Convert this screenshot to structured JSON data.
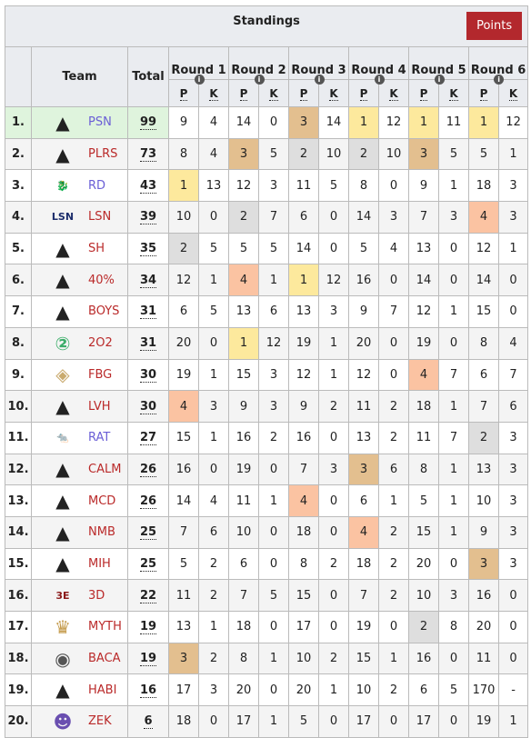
{
  "title": "Standings",
  "points_button": "Points",
  "headers": {
    "team": "Team",
    "total": "Total",
    "rounds": [
      "Round 1",
      "Round 2",
      "Round 3",
      "Round 4",
      "Round 5",
      "Round 6"
    ],
    "p": "P",
    "k": "K"
  },
  "colors": {
    "gold": "#fde99d",
    "silver": "#dedede",
    "bronze": "#e3bf8f",
    "fourth": "#fbc3a2",
    "leader": "#dff4dd",
    "button": "#b3282d",
    "link_blue": "#6b5fd6",
    "link_red": "#ba2a2a"
  },
  "rows": [
    {
      "rank": "1.",
      "team": "PSN",
      "logo": "apex-logo",
      "link": "blue",
      "total": "99",
      "r": [
        [
          "9",
          "4"
        ],
        [
          "14",
          "0"
        ],
        [
          "3",
          "14"
        ],
        [
          "1",
          "12"
        ],
        [
          "1",
          "11"
        ],
        [
          "1",
          "12"
        ]
      ]
    },
    {
      "rank": "2.",
      "team": "PLRS",
      "logo": "apex-logo",
      "link": "red",
      "total": "73",
      "r": [
        [
          "8",
          "4"
        ],
        [
          "3",
          "5"
        ],
        [
          "2",
          "10"
        ],
        [
          "2",
          "10"
        ],
        [
          "3",
          "5"
        ],
        [
          "5",
          "1"
        ]
      ]
    },
    {
      "rank": "3.",
      "team": "RD",
      "logo": "red-dragon-logo",
      "link": "blue",
      "total": "43",
      "r": [
        [
          "1",
          "13"
        ],
        [
          "12",
          "3"
        ],
        [
          "11",
          "5"
        ],
        [
          "8",
          "0"
        ],
        [
          "9",
          "1"
        ],
        [
          "18",
          "3"
        ]
      ]
    },
    {
      "rank": "4.",
      "team": "LSN",
      "logo": "lsn-logo",
      "link": "red",
      "total": "39",
      "r": [
        [
          "10",
          "0"
        ],
        [
          "2",
          "7"
        ],
        [
          "6",
          "0"
        ],
        [
          "14",
          "3"
        ],
        [
          "7",
          "3"
        ],
        [
          "4",
          "3"
        ]
      ]
    },
    {
      "rank": "5.",
      "team": "SH",
      "logo": "apex-logo",
      "link": "red",
      "total": "35",
      "r": [
        [
          "2",
          "5"
        ],
        [
          "5",
          "5"
        ],
        [
          "14",
          "0"
        ],
        [
          "5",
          "4"
        ],
        [
          "13",
          "0"
        ],
        [
          "12",
          "1"
        ]
      ]
    },
    {
      "rank": "6.",
      "team": "40%",
      "logo": "apex-logo",
      "link": "red",
      "total": "34",
      "r": [
        [
          "12",
          "1"
        ],
        [
          "4",
          "1"
        ],
        [
          "1",
          "12"
        ],
        [
          "16",
          "0"
        ],
        [
          "14",
          "0"
        ],
        [
          "14",
          "0"
        ]
      ]
    },
    {
      "rank": "7.",
      "team": "BOYS",
      "logo": "apex-logo",
      "link": "red",
      "total": "31",
      "r": [
        [
          "6",
          "5"
        ],
        [
          "13",
          "6"
        ],
        [
          "13",
          "3"
        ],
        [
          "9",
          "7"
        ],
        [
          "12",
          "1"
        ],
        [
          "15",
          "0"
        ]
      ]
    },
    {
      "rank": "8.",
      "team": "2O2",
      "logo": "2o2-logo",
      "link": "red",
      "total": "31",
      "r": [
        [
          "20",
          "0"
        ],
        [
          "1",
          "12"
        ],
        [
          "19",
          "1"
        ],
        [
          "20",
          "0"
        ],
        [
          "19",
          "0"
        ],
        [
          "8",
          "4"
        ]
      ]
    },
    {
      "rank": "9.",
      "team": "FBG",
      "logo": "fbg-logo",
      "link": "red",
      "total": "30",
      "r": [
        [
          "19",
          "1"
        ],
        [
          "15",
          "3"
        ],
        [
          "12",
          "1"
        ],
        [
          "12",
          "0"
        ],
        [
          "4",
          "7"
        ],
        [
          "6",
          "7"
        ]
      ]
    },
    {
      "rank": "10.",
      "team": "LVH",
      "logo": "apex-logo",
      "link": "red",
      "total": "30",
      "r": [
        [
          "4",
          "3"
        ],
        [
          "9",
          "3"
        ],
        [
          "9",
          "2"
        ],
        [
          "11",
          "2"
        ],
        [
          "18",
          "1"
        ],
        [
          "7",
          "6"
        ]
      ]
    },
    {
      "rank": "11.",
      "team": "RAT",
      "logo": "rat-logo",
      "link": "blue",
      "total": "27",
      "r": [
        [
          "15",
          "1"
        ],
        [
          "16",
          "2"
        ],
        [
          "16",
          "0"
        ],
        [
          "13",
          "2"
        ],
        [
          "11",
          "7"
        ],
        [
          "2",
          "3"
        ]
      ]
    },
    {
      "rank": "12.",
      "team": "CALM",
      "logo": "apex-logo",
      "link": "red",
      "total": "26",
      "r": [
        [
          "16",
          "0"
        ],
        [
          "19",
          "0"
        ],
        [
          "7",
          "3"
        ],
        [
          "3",
          "6"
        ],
        [
          "8",
          "1"
        ],
        [
          "13",
          "3"
        ]
      ]
    },
    {
      "rank": "13.",
      "team": "MCD",
      "logo": "apex-logo",
      "link": "red",
      "total": "26",
      "r": [
        [
          "14",
          "4"
        ],
        [
          "11",
          "1"
        ],
        [
          "4",
          "0"
        ],
        [
          "6",
          "1"
        ],
        [
          "5",
          "1"
        ],
        [
          "10",
          "3"
        ]
      ]
    },
    {
      "rank": "14.",
      "team": "NMB",
      "logo": "apex-logo",
      "link": "red",
      "total": "25",
      "r": [
        [
          "7",
          "6"
        ],
        [
          "10",
          "0"
        ],
        [
          "18",
          "0"
        ],
        [
          "4",
          "2"
        ],
        [
          "15",
          "1"
        ],
        [
          "9",
          "3"
        ]
      ]
    },
    {
      "rank": "15.",
      "team": "MIH",
      "logo": "apex-logo",
      "link": "red",
      "total": "25",
      "r": [
        [
          "5",
          "2"
        ],
        [
          "6",
          "0"
        ],
        [
          "8",
          "2"
        ],
        [
          "18",
          "2"
        ],
        [
          "20",
          "0"
        ],
        [
          "3",
          "3"
        ]
      ]
    },
    {
      "rank": "16.",
      "team": "3D",
      "logo": "3d-dragon-logo",
      "link": "red",
      "total": "22",
      "r": [
        [
          "11",
          "2"
        ],
        [
          "7",
          "5"
        ],
        [
          "15",
          "0"
        ],
        [
          "7",
          "2"
        ],
        [
          "10",
          "3"
        ],
        [
          "16",
          "0"
        ]
      ]
    },
    {
      "rank": "17.",
      "team": "MYTH",
      "logo": "myth-logo",
      "link": "red",
      "total": "19",
      "r": [
        [
          "13",
          "1"
        ],
        [
          "18",
          "0"
        ],
        [
          "17",
          "0"
        ],
        [
          "19",
          "0"
        ],
        [
          "2",
          "8"
        ],
        [
          "20",
          "0"
        ]
      ]
    },
    {
      "rank": "18.",
      "team": "BACA",
      "logo": "baca-logo",
      "link": "red",
      "total": "19",
      "r": [
        [
          "3",
          "2"
        ],
        [
          "8",
          "1"
        ],
        [
          "10",
          "2"
        ],
        [
          "15",
          "1"
        ],
        [
          "16",
          "0"
        ],
        [
          "11",
          "0"
        ]
      ]
    },
    {
      "rank": "19.",
      "team": "HABI",
      "logo": "apex-logo",
      "link": "red",
      "total": "16",
      "r": [
        [
          "17",
          "3"
        ],
        [
          "20",
          "0"
        ],
        [
          "20",
          "1"
        ],
        [
          "10",
          "2"
        ],
        [
          "6",
          "5"
        ],
        [
          "170",
          "-"
        ]
      ]
    },
    {
      "rank": "20.",
      "team": "ZEK",
      "logo": "zek-logo",
      "link": "red",
      "total": "6",
      "r": [
        [
          "18",
          "0"
        ],
        [
          "17",
          "1"
        ],
        [
          "5",
          "0"
        ],
        [
          "17",
          "0"
        ],
        [
          "17",
          "0"
        ],
        [
          "19",
          "1"
        ]
      ]
    }
  ]
}
